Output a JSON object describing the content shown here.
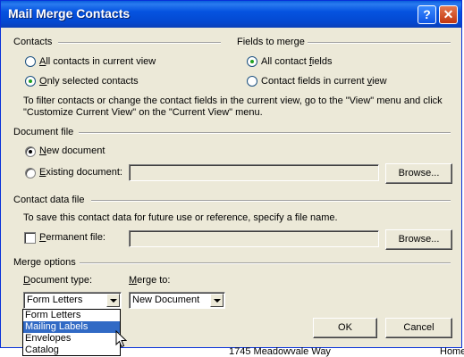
{
  "window": {
    "title": "Mail Merge Contacts",
    "help_glyph": "?",
    "close_glyph": "✕"
  },
  "contacts": {
    "label": "Contacts",
    "all": {
      "pre": "",
      "key": "A",
      "post": "ll contacts in current view",
      "selected": false
    },
    "only": {
      "pre": "",
      "key": "O",
      "post": "nly selected contacts",
      "selected": true
    },
    "note_line1": "To filter contacts or change the contact fields in the current view, go to the \"View\" menu and click",
    "note_line2": "\"Customize Current View\" on the \"Current View\" menu."
  },
  "fields": {
    "label": "Fields to merge",
    "all": {
      "pre": "All contact ",
      "key": "f",
      "post": "ields",
      "selected": true
    },
    "current": {
      "pre": "Contact fields in current ",
      "key": "v",
      "post": "iew",
      "selected": false
    }
  },
  "document_file": {
    "label": "Document file",
    "new_doc": {
      "pre": "",
      "key": "N",
      "post": "ew document",
      "selected": true
    },
    "existing": {
      "pre": "",
      "key": "E",
      "post": "xisting document:",
      "selected": false
    },
    "existing_value": "",
    "browse_label": "Browse..."
  },
  "contact_data": {
    "label": "Contact data file",
    "note": "To save this contact data for future use or reference, specify a file name.",
    "permanent": {
      "pre": "",
      "key": "P",
      "post": "ermanent file:",
      "checked": false
    },
    "file_value": "",
    "browse_label": "Browse..."
  },
  "merge_options": {
    "label": "Merge options",
    "doc_type_label": "Document type:",
    "doc_type_value": "Form Letters",
    "merge_to_label": "Merge to:",
    "merge_to_value": "New Document",
    "dropdown_options": [
      "Form Letters",
      "Mailing Labels",
      "Envelopes",
      "Catalog"
    ],
    "dropdown_highlighted": "Mailing Labels"
  },
  "buttons": {
    "ok": "OK",
    "cancel": "Cancel"
  },
  "background": {
    "address": "1745 Meadowvale Way",
    "home_label": "Home:"
  }
}
